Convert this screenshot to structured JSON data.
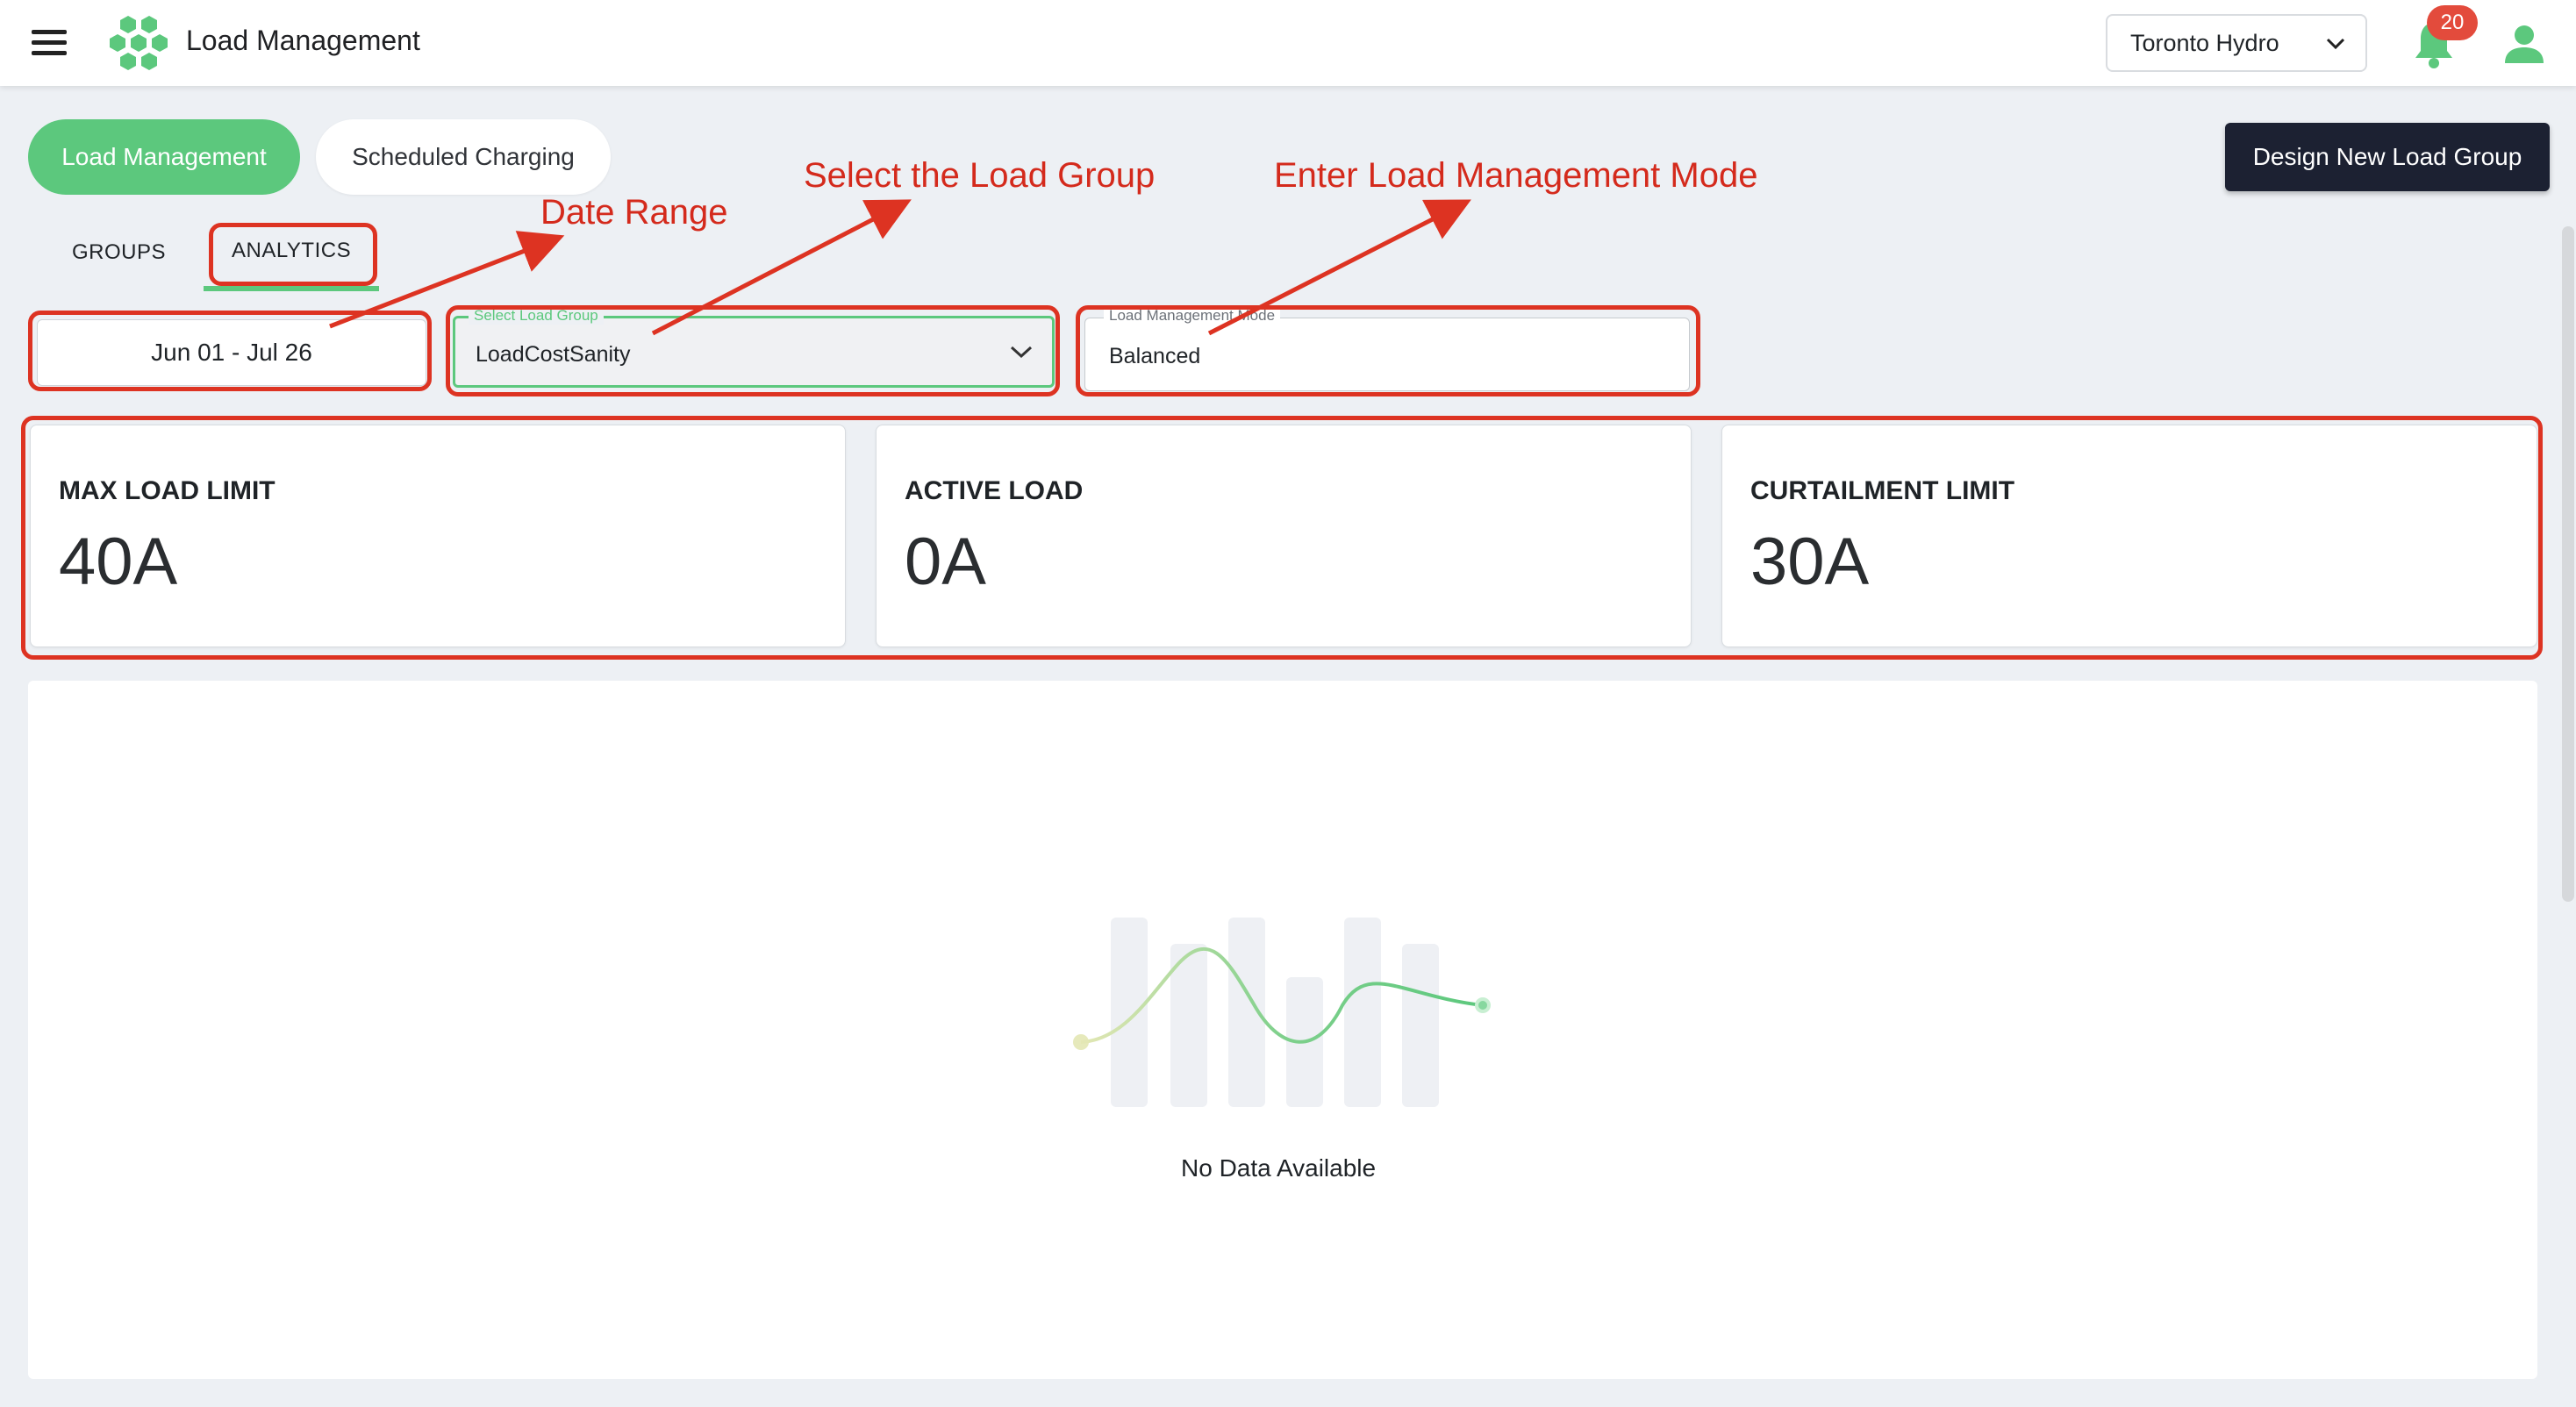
{
  "header": {
    "title": "Load Management",
    "organization": "Toronto Hydro",
    "notification_count": "20"
  },
  "top_tabs": {
    "load_management": "Load Management",
    "scheduled_charging": "Scheduled Charging"
  },
  "design_button": "Design New Load Group",
  "sub_tabs": {
    "groups": "GROUPS",
    "analytics": "ANALYTICS"
  },
  "filters": {
    "date_range": "Jun 01 - Jul 26",
    "load_group_label": "Select Load Group",
    "load_group_value": "LoadCostSanity",
    "mode_label": "Load Management Mode",
    "mode_value": "Balanced"
  },
  "stats": [
    {
      "label": "MAX LOAD LIMIT",
      "value": "40A"
    },
    {
      "label": "ACTIVE LOAD",
      "value": "0A"
    },
    {
      "label": "CURTAILMENT LIMIT",
      "value": "30A"
    }
  ],
  "chart": {
    "empty_message": "No Data Available"
  },
  "annotations": {
    "date_range": "Date Range",
    "select_group": "Select the Load Group",
    "mode": "Enter Load Management Mode"
  },
  "colors": {
    "accent_green": "#5cc87d",
    "dark_button": "#1c2132",
    "annotation_red": "#dd3322",
    "badge_red": "#e34b3c"
  }
}
